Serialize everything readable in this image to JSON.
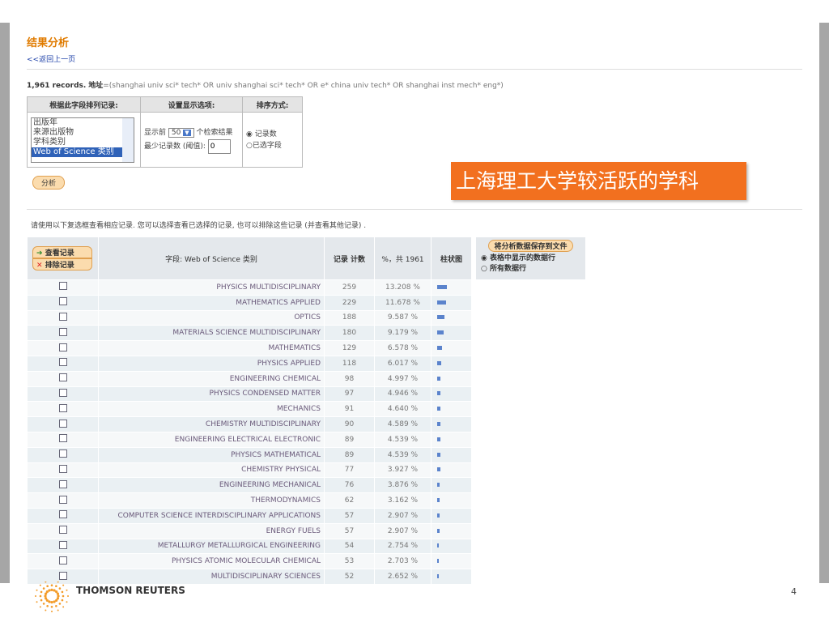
{
  "page": {
    "title": "结果分析",
    "back_link": "<<返回上一页",
    "records_count": "1,961 records.",
    "query_label": "地址",
    "query": "=(shanghai univ sci* tech* OR univ shanghai sci* tech* OR e* china univ tech* OR shanghai inst mech* eng*)"
  },
  "options": {
    "col1": "根据此字段排列记录:",
    "col2": "设置显示选项:",
    "col3": "排序方式:",
    "fields": [
      "出版年",
      "来源出版物",
      "学科类别",
      "Web of Science 类别"
    ],
    "show_prefix": "显示前",
    "show_value": "50",
    "show_suffix": "个检索结果",
    "min_label": "最少记录数 (阈值):",
    "min_value": "0",
    "sort_records": "记录数",
    "sort_field": "已选字段",
    "analyze": "分析"
  },
  "banner": "上海理工大学较活跃的学科",
  "hint": "请使用以下复选框查看相应记录. 您可以选择查看已选择的记录, 也可以排除这些记录 (并查看其他记录) .",
  "table": {
    "view": "查看记录",
    "exclude": "排除记录",
    "h_field": "字段: Web of Science 类别",
    "h_count": "记录 计数",
    "h_pct": "%，共 1961",
    "h_bar": "柱状图",
    "rows": [
      [
        "PHYSICS MULTIDISCIPLINARY",
        "259",
        "13.208 %",
        13.208
      ],
      [
        "MATHEMATICS APPLIED",
        "229",
        "11.678 %",
        11.678
      ],
      [
        "OPTICS",
        "188",
        "9.587 %",
        9.587
      ],
      [
        "MATERIALS SCIENCE MULTIDISCIPLINARY",
        "180",
        "9.179 %",
        9.179
      ],
      [
        "MATHEMATICS",
        "129",
        "6.578 %",
        6.578
      ],
      [
        "PHYSICS APPLIED",
        "118",
        "6.017 %",
        6.017
      ],
      [
        "ENGINEERING CHEMICAL",
        "98",
        "4.997 %",
        4.997
      ],
      [
        "PHYSICS CONDENSED MATTER",
        "97",
        "4.946 %",
        4.946
      ],
      [
        "MECHANICS",
        "91",
        "4.640 %",
        4.64
      ],
      [
        "CHEMISTRY MULTIDISCIPLINARY",
        "90",
        "4.589 %",
        4.589
      ],
      [
        "ENGINEERING ELECTRICAL ELECTRONIC",
        "89",
        "4.539 %",
        4.539
      ],
      [
        "PHYSICS MATHEMATICAL",
        "89",
        "4.539 %",
        4.539
      ],
      [
        "CHEMISTRY PHYSICAL",
        "77",
        "3.927 %",
        3.927
      ],
      [
        "ENGINEERING MECHANICAL",
        "76",
        "3.876 %",
        3.876
      ],
      [
        "THERMODYNAMICS",
        "62",
        "3.162 %",
        3.162
      ],
      [
        "COMPUTER SCIENCE INTERDISCIPLINARY APPLICATIONS",
        "57",
        "2.907 %",
        2.907
      ],
      [
        "ENERGY FUELS",
        "57",
        "2.907 %",
        2.907
      ],
      [
        "METALLURGY METALLURGICAL ENGINEERING",
        "54",
        "2.754 %",
        2.754
      ],
      [
        "PHYSICS ATOMIC MOLECULAR CHEMICAL",
        "53",
        "2.703 %",
        2.703
      ],
      [
        "MULTIDISCIPLINARY SCIENCES",
        "52",
        "2.652 %",
        2.652
      ]
    ]
  },
  "save": {
    "button": "将分析数据保存到文件",
    "opt1": "表格中显示的数据行",
    "opt2": "所有数据行"
  },
  "footer": {
    "brand": "THOMSON REUTERS",
    "page": "4"
  },
  "colors": {
    "accent": "#e07b00",
    "banner": "#f2701f",
    "bar": "#5b83cc"
  }
}
